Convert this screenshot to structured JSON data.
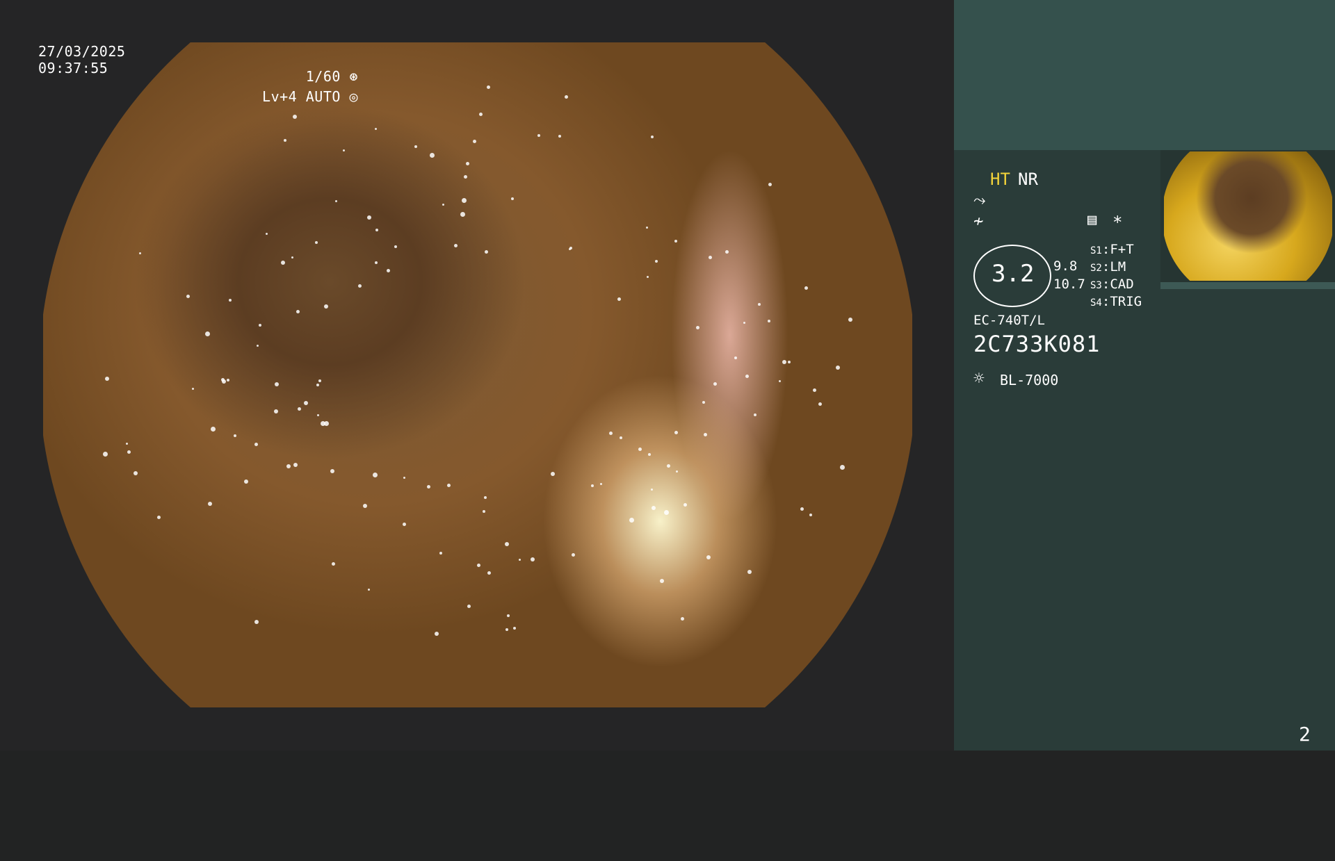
{
  "overlay": {
    "date": "27/03/2025",
    "time": "09:37:55",
    "shutter": "1/60",
    "shutter_icon": "aperture-icon",
    "level": "Lv+4 AUTO",
    "level_icon": "iris-icon"
  },
  "panel": {
    "mode_ht": "HT",
    "mode_nr": "NR",
    "icon_1": "⤳",
    "icon_2": "≁",
    "memo_glyph": "▤",
    "star_glyph": "*",
    "zoom_value": "3.2",
    "zoom_sub_1": "9.8",
    "zoom_sub_2": "10.7",
    "switches": [
      {
        "key": "S1",
        "label": "F+T"
      },
      {
        "key": "S2",
        "label": "LM"
      },
      {
        "key": "S3",
        "label": "CAD"
      },
      {
        "key": "S4",
        "label": "TRIG"
      }
    ],
    "scope_model": "EC-740T/L",
    "scope_serial": "2C733K081",
    "light_glyph": "☼",
    "light_source": "BL-7000",
    "page_number": "2"
  },
  "colors": {
    "background": "#222323",
    "panel": "#2a3c39",
    "panel_top": "#35514d",
    "ht_highlight": "#f3d33a"
  }
}
